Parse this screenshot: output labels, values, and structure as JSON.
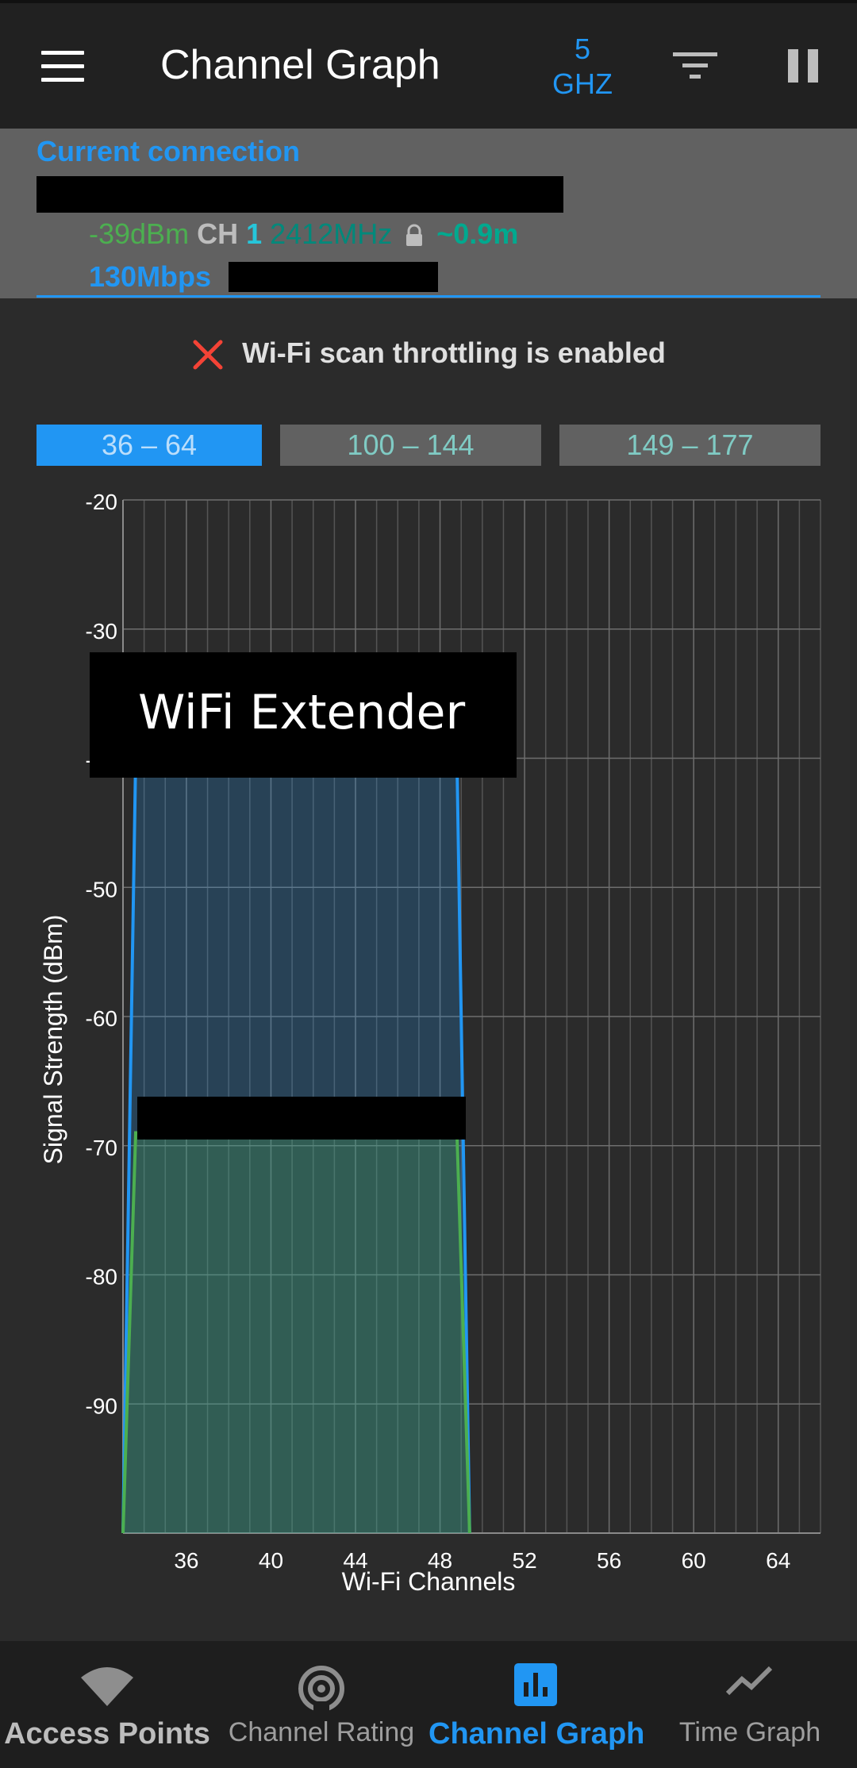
{
  "app": {
    "title": "Channel Graph",
    "band_value": "5",
    "band_unit": "GHZ"
  },
  "connection": {
    "heading": "Current connection",
    "signal": "-39dBm",
    "ch_label": "CH",
    "channel": "1",
    "frequency": "2412MHz",
    "distance": "~0.9m",
    "speed": "130Mbps"
  },
  "throttle_message": "Wi-Fi scan throttling is enabled",
  "range_tabs": [
    {
      "label": "36 – 64",
      "active": true
    },
    {
      "label": "100 – 144",
      "active": false
    },
    {
      "label": "149 – 177",
      "active": false
    }
  ],
  "chart_data": {
    "type": "area",
    "xlabel": "Wi-Fi Channels",
    "ylabel": "Signal Strength (dBm)",
    "ylim": [
      -100,
      -20
    ],
    "xlim": [
      33,
      66
    ],
    "x_ticks": [
      36,
      40,
      44,
      48,
      52,
      56,
      60,
      64
    ],
    "y_ticks": [
      -20,
      -30,
      -40,
      -50,
      -60,
      -70,
      -80,
      -90
    ],
    "grid": true,
    "series": [
      {
        "name": "WiFi Extender",
        "color": "#2196f3",
        "points": [
          [
            33.0,
            -100
          ],
          [
            33.6,
            -40
          ],
          [
            48.8,
            -40
          ],
          [
            49.4,
            -100
          ]
        ]
      },
      {
        "name": "",
        "color": "#4caf50",
        "points": [
          [
            33.0,
            -100
          ],
          [
            33.6,
            -69
          ],
          [
            48.8,
            -69
          ],
          [
            49.4,
            -100
          ]
        ]
      }
    ]
  },
  "nav": [
    {
      "label": "Access Points",
      "icon": "wifi-icon",
      "state": "bold"
    },
    {
      "label": "Channel Rating",
      "icon": "radar-icon",
      "state": "normal"
    },
    {
      "label": "Channel Graph",
      "icon": "bar-chart-icon",
      "state": "active"
    },
    {
      "label": "Time Graph",
      "icon": "line-chart-icon",
      "state": "normal"
    }
  ],
  "colors": {
    "accent": "#2196f3",
    "green": "#4caf50",
    "teal": "#26c6da",
    "error": "#f44336"
  }
}
